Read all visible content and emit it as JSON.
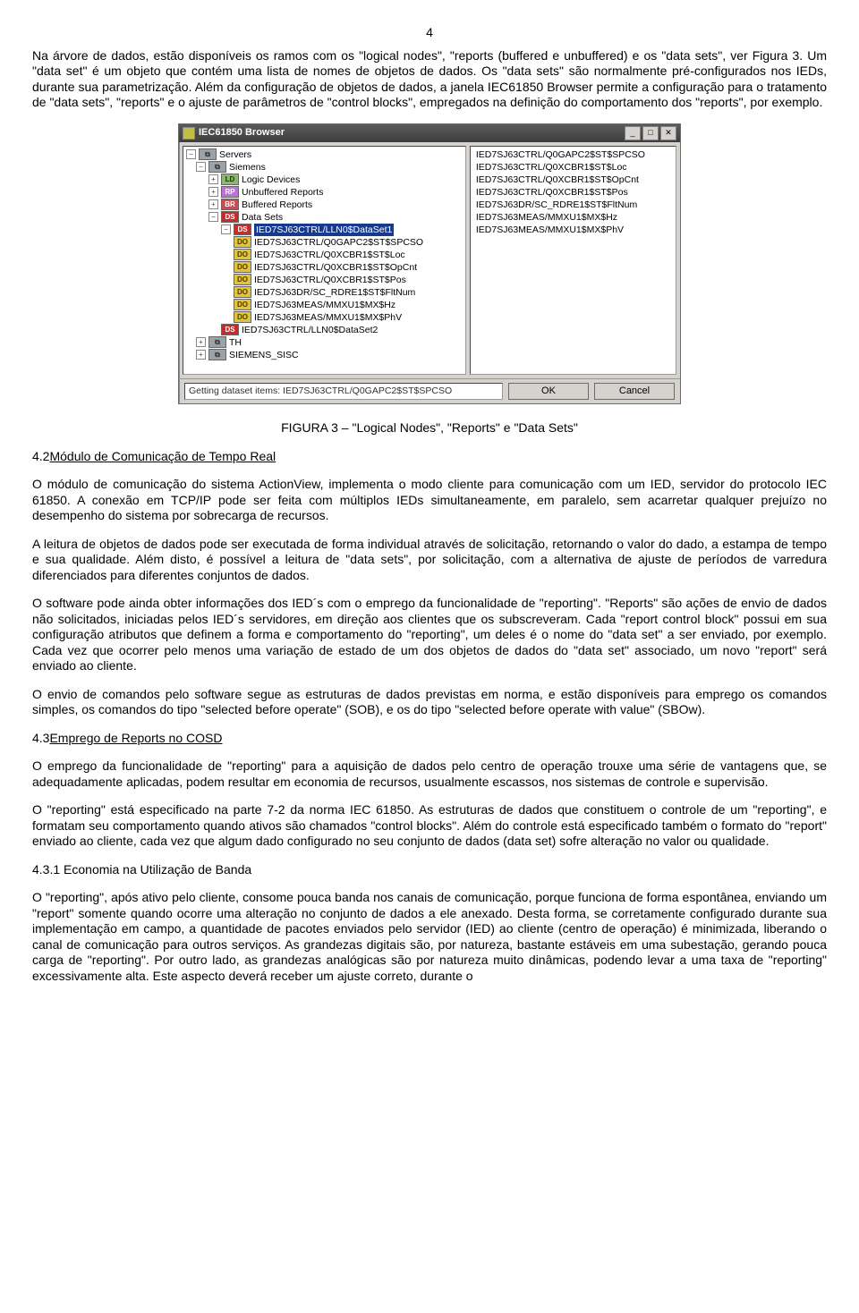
{
  "page_number": "4",
  "paragraphs": {
    "p1": "Na árvore de dados, estão disponíveis os ramos com os \"logical nodes\", \"reports (buffered e unbuffered) e os \"data sets\", ver Figura 3. Um \"data set\" é um objeto que contém uma lista de nomes de objetos de dados. Os \"data sets\" são normalmente pré-configurados nos IEDs, durante sua parametrização. Além da configuração de objetos de dados, a janela IEC61850 Browser permite a configuração para o tratamento de \"data sets\", \"reports\" e o ajuste de parâmetros de \"control blocks\", empregados na definição do comportamento dos \"reports\", por exemplo.",
    "fig_caption": "FIGURA 3 – \"Logical Nodes\", \"Reports\" e \"Data Sets\"",
    "h42_num": "4.2 ",
    "h42": "Módulo de Comunicação de Tempo Real",
    "p2": "O módulo de comunicação do sistema ActionView, implementa o modo cliente para comunicação com um IED, servidor do protocolo IEC 61850. A conexão em TCP/IP pode ser feita com múltiplos IEDs simultaneamente, em paralelo, sem acarretar qualquer prejuízo no desempenho do sistema por sobrecarga de recursos.",
    "p3": "A leitura de objetos de dados pode ser executada de forma individual através de solicitação, retornando o valor do dado, a estampa de tempo e sua qualidade. Além disto, é possível a leitura de \"data sets\", por solicitação, com a alternativa de ajuste de períodos de varredura diferenciados para diferentes conjuntos de dados.",
    "p4": "O software pode ainda obter informações dos IED´s com o emprego da funcionalidade de \"reporting\". \"Reports\" são ações de envio de dados não solicitados, iniciadas pelos IED´s servidores, em direção aos clientes que os subscreveram. Cada \"report control block\" possui em sua configuração atributos que definem a forma e comportamento do \"reporting\", um deles é o nome do \"data set\" a ser enviado, por exemplo. Cada vez que ocorrer pelo menos uma variação de estado de um dos objetos de dados do \"data set\" associado, um novo \"report\" será enviado ao cliente.",
    "p5": "O envio de comandos pelo software segue as estruturas de dados previstas em norma, e estão disponíveis para emprego os comandos simples, os comandos do tipo \"selected before operate\" (SOB), e os do tipo \"selected before operate with value\" (SBOw).",
    "h43_num": "4.3 ",
    "h43": "Emprego de Reports no COSD",
    "p6": "O emprego da funcionalidade de \"reporting\" para a aquisição de dados pelo centro de operação trouxe uma série de vantagens que, se adequadamente aplicadas, podem resultar em economia de recursos, usualmente escassos, nos sistemas de controle e supervisão.",
    "p7": "O \"reporting\" está especificado na parte 7-2 da norma IEC 61850. As estruturas de dados que constituem o controle de um \"reporting\", e formatam seu comportamento quando ativos são chamados \"control blocks\". Além do controle está especificado também o formato do \"report\" enviado ao cliente, cada vez que algum dado configurado no seu conjunto de dados (data set) sofre alteração no valor ou qualidade.",
    "h431": "4.3.1 Economia na Utilização de Banda",
    "p8": "O \"reporting\", após ativo pelo cliente, consome pouca banda nos canais de comunicação, porque funciona de forma espontânea, enviando um \"report\" somente quando ocorre uma alteração no conjunto de dados a ele anexado. Desta forma, se corretamente configurado durante sua implementação em campo, a quantidade de pacotes enviados pelo servidor (IED) ao cliente (centro de operação) é minimizada, liberando o canal de comunicação para outros serviços. As grandezas digitais são, por natureza, bastante estáveis em uma subestação, gerando pouca carga de \"reporting\". Por outro lado, as grandezas analógicas são por natureza muito dinâmicas, podendo levar a uma taxa de \"reporting\" excessivamente alta. Este aspecto deverá receber um ajuste correto, durante o"
  },
  "dialog": {
    "title": "IEC61850 Browser",
    "status": "Getting dataset items: IED7SJ63CTRL/Q0GAPC2$ST$SPCSO",
    "ok": "OK",
    "cancel": "Cancel",
    "tree": {
      "servers": "Servers",
      "siemens": "Siemens",
      "ld": "Logic Devices",
      "rp": "Unbuffered Reports",
      "br": "Buffered Reports",
      "ds": "Data Sets",
      "ds1": "IED7SJ63CTRL/LLN0$DataSet1",
      "do": [
        "IED7SJ63CTRL/Q0GAPC2$ST$SPCSO",
        "IED7SJ63CTRL/Q0XCBR1$ST$Loc",
        "IED7SJ63CTRL/Q0XCBR1$ST$OpCnt",
        "IED7SJ63CTRL/Q0XCBR1$ST$Pos",
        "IED7SJ63DR/SC_RDRE1$ST$FltNum",
        "IED7SJ63MEAS/MMXU1$MX$Hz",
        "IED7SJ63MEAS/MMXU1$MX$PhV"
      ],
      "ds2": "IED7SJ63CTRL/LLN0$DataSet2",
      "th": "TH",
      "sisc": "SIEMENS_SISC"
    },
    "right": [
      "IED7SJ63CTRL/Q0GAPC2$ST$SPCSO",
      "IED7SJ63CTRL/Q0XCBR1$ST$Loc",
      "IED7SJ63CTRL/Q0XCBR1$ST$OpCnt",
      "IED7SJ63CTRL/Q0XCBR1$ST$Pos",
      "IED7SJ63DR/SC_RDRE1$ST$FltNum",
      "IED7SJ63MEAS/MMXU1$MX$Hz",
      "IED7SJ63MEAS/MMXU1$MX$PhV"
    ],
    "icon_labels": {
      "ld": "LD",
      "rp": "RP",
      "br": "BR",
      "ds": "DS",
      "do": "DO"
    }
  }
}
